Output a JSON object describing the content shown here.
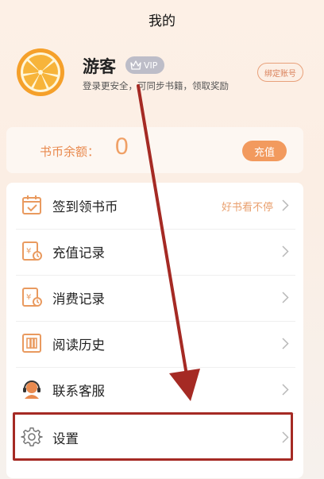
{
  "header": {
    "title": "我的"
  },
  "user": {
    "name": "游客",
    "vip_label": "VIP",
    "description": "登录更安全，可同步书籍，领取奖励",
    "bind_label": "绑定账号"
  },
  "balance": {
    "label": "书币余额：",
    "value": "0",
    "recharge_label": "充值"
  },
  "menu": {
    "items": [
      {
        "label": "签到领书币",
        "extra": "好书看不停",
        "icon": "calendar-check-icon"
      },
      {
        "label": "充值记录",
        "extra": "",
        "icon": "recharge-record-icon"
      },
      {
        "label": "消费记录",
        "extra": "",
        "icon": "consume-record-icon"
      },
      {
        "label": "阅读历史",
        "extra": "",
        "icon": "book-history-icon"
      },
      {
        "label": "联系客服",
        "extra": "",
        "icon": "customer-service-icon"
      },
      {
        "label": "设置",
        "extra": "",
        "icon": "gear-icon"
      }
    ]
  },
  "colors": {
    "accent": "#f29a5e",
    "annotation": "#a52a24"
  }
}
